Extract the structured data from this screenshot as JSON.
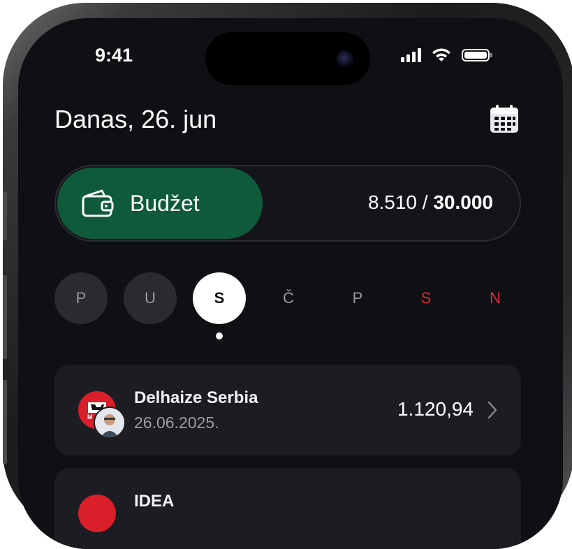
{
  "status_bar": {
    "time": "9:41"
  },
  "header": {
    "title": "Danas, 26. jun",
    "calendar_icon": "calendar-icon"
  },
  "budget": {
    "label": "Budžet",
    "icon": "wallet-icon",
    "spent": "8.510",
    "separator": " / ",
    "limit": "30.000",
    "accent_color": "#0f5a3a"
  },
  "week_days": [
    {
      "label": "P",
      "state": "past"
    },
    {
      "label": "U",
      "state": "past"
    },
    {
      "label": "S",
      "state": "active"
    },
    {
      "label": "Č",
      "state": "upcoming"
    },
    {
      "label": "P",
      "state": "upcoming"
    },
    {
      "label": "S",
      "state": "weekend"
    },
    {
      "label": "N",
      "state": "weekend"
    }
  ],
  "transactions": [
    {
      "merchant": "Delhaize Serbia",
      "date": "26.06.2025.",
      "amount": "1.120,94",
      "logo": "delhaize-logo",
      "avatar": "user-avatar"
    },
    {
      "merchant": "IDEA",
      "date": "",
      "amount": "",
      "logo": "idea-logo",
      "avatar": ""
    }
  ],
  "colors": {
    "background": "#0f1014",
    "card": "#1c1d22",
    "weekend": "#e0283f"
  }
}
